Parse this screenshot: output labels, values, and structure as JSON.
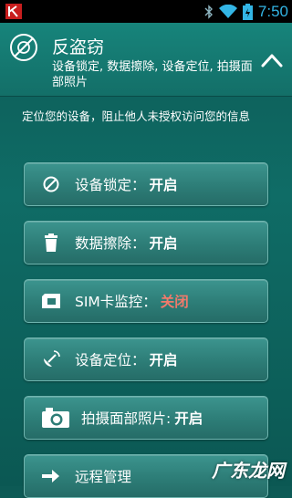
{
  "status_bar": {
    "time": "7:50"
  },
  "header": {
    "title": "反盗窃",
    "subtitle": "设备锁定, 数据擦除, 设备定位, 拍摄面部照片"
  },
  "intro_text": "定位您的设备，阻止他人未授权访问您的信息",
  "items": [
    {
      "icon": "block-icon",
      "label": "设备锁定：",
      "value": "开启"
    },
    {
      "icon": "trash-icon",
      "label": "数据擦除：",
      "value": "开启"
    },
    {
      "icon": "sim-card-icon",
      "label": "SIM卡监控：",
      "value": "关闭"
    },
    {
      "icon": "satellite-icon",
      "label": "设备定位：",
      "value": "开启"
    },
    {
      "icon": "camera-icon",
      "label": "拍摄面部照片:",
      "value": "开启"
    },
    {
      "icon": "arrow-right-icon",
      "label": "远程管理",
      "value": ""
    }
  ],
  "watermark": "广东龙网",
  "colors": {
    "off_value": "#f07a6b",
    "accent": "#33b5e5"
  }
}
